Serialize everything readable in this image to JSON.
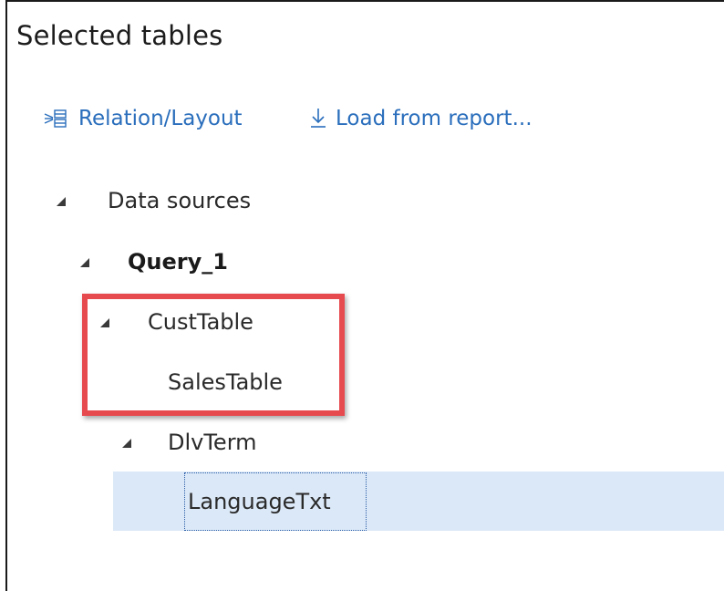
{
  "panel": {
    "title": "Selected tables"
  },
  "toolbar": {
    "relation_label": "Relation/Layout",
    "load_label": "Load from report...",
    "relation_icon": "relation-layout-icon",
    "load_icon": "download-arrow-icon",
    "accent_color": "#2a6ebc"
  },
  "tree": {
    "root_label": "Data sources",
    "query_label": "Query_1",
    "items": [
      {
        "label": "CustTable",
        "expanded": true
      },
      {
        "label": "SalesTable",
        "expanded": false
      },
      {
        "label": "DlvTerm",
        "expanded": true
      },
      {
        "label": "LanguageTxt",
        "selected": true
      }
    ]
  },
  "annotation": {
    "highlight_color": "#e64a4f",
    "highlighted_items": [
      "CustTable",
      "SalesTable"
    ]
  },
  "selection_color": "#dbe8f7"
}
